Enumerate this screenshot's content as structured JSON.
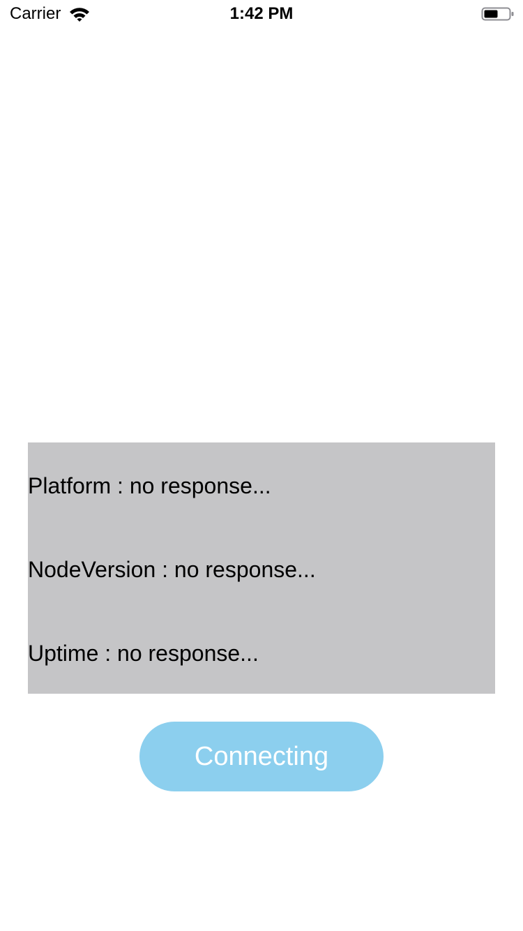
{
  "status_bar": {
    "carrier": "Carrier",
    "time": "1:42 PM",
    "wifi_icon": "wifi-icon",
    "battery_icon": "battery-icon"
  },
  "info": {
    "platform": "Platform : no response...",
    "node_version": "NodeVersion : no response...",
    "uptime": "Uptime : no response..."
  },
  "button": {
    "label": "Connecting",
    "color": "#8ccfee"
  },
  "colors": {
    "panel_background": "#c5c5c7",
    "page_background": "#ffffff"
  }
}
